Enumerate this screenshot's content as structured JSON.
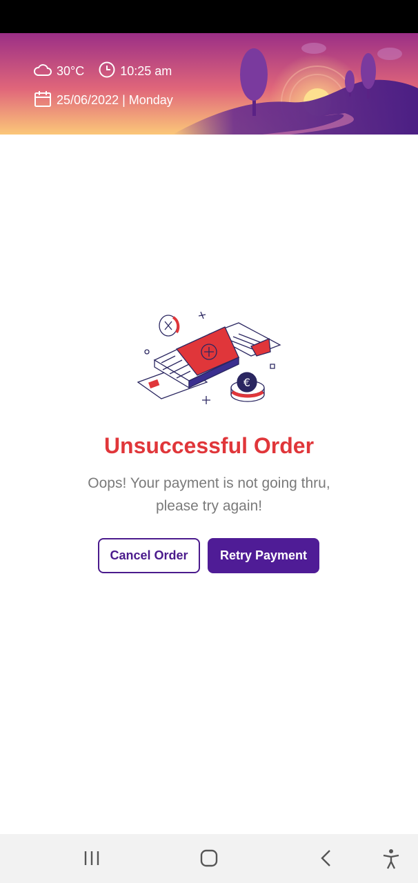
{
  "header": {
    "temperature": "30°C",
    "time": "10:25 am",
    "date": "25/06/2022 | Monday"
  },
  "order": {
    "title": "Unsuccessful Order",
    "message_line1": "Oops! Your payment is not going thru,",
    "message_line2": "please try again!"
  },
  "buttons": {
    "cancel_label": "Cancel Order",
    "retry_label": "Retry Payment"
  },
  "colors": {
    "error_red": "#e0363a",
    "brand_purple": "#4f1c96"
  },
  "icons": [
    "cloud-icon",
    "clock-icon",
    "calendar-icon",
    "recent-apps-icon",
    "home-icon",
    "back-icon",
    "accessibility-icon"
  ]
}
